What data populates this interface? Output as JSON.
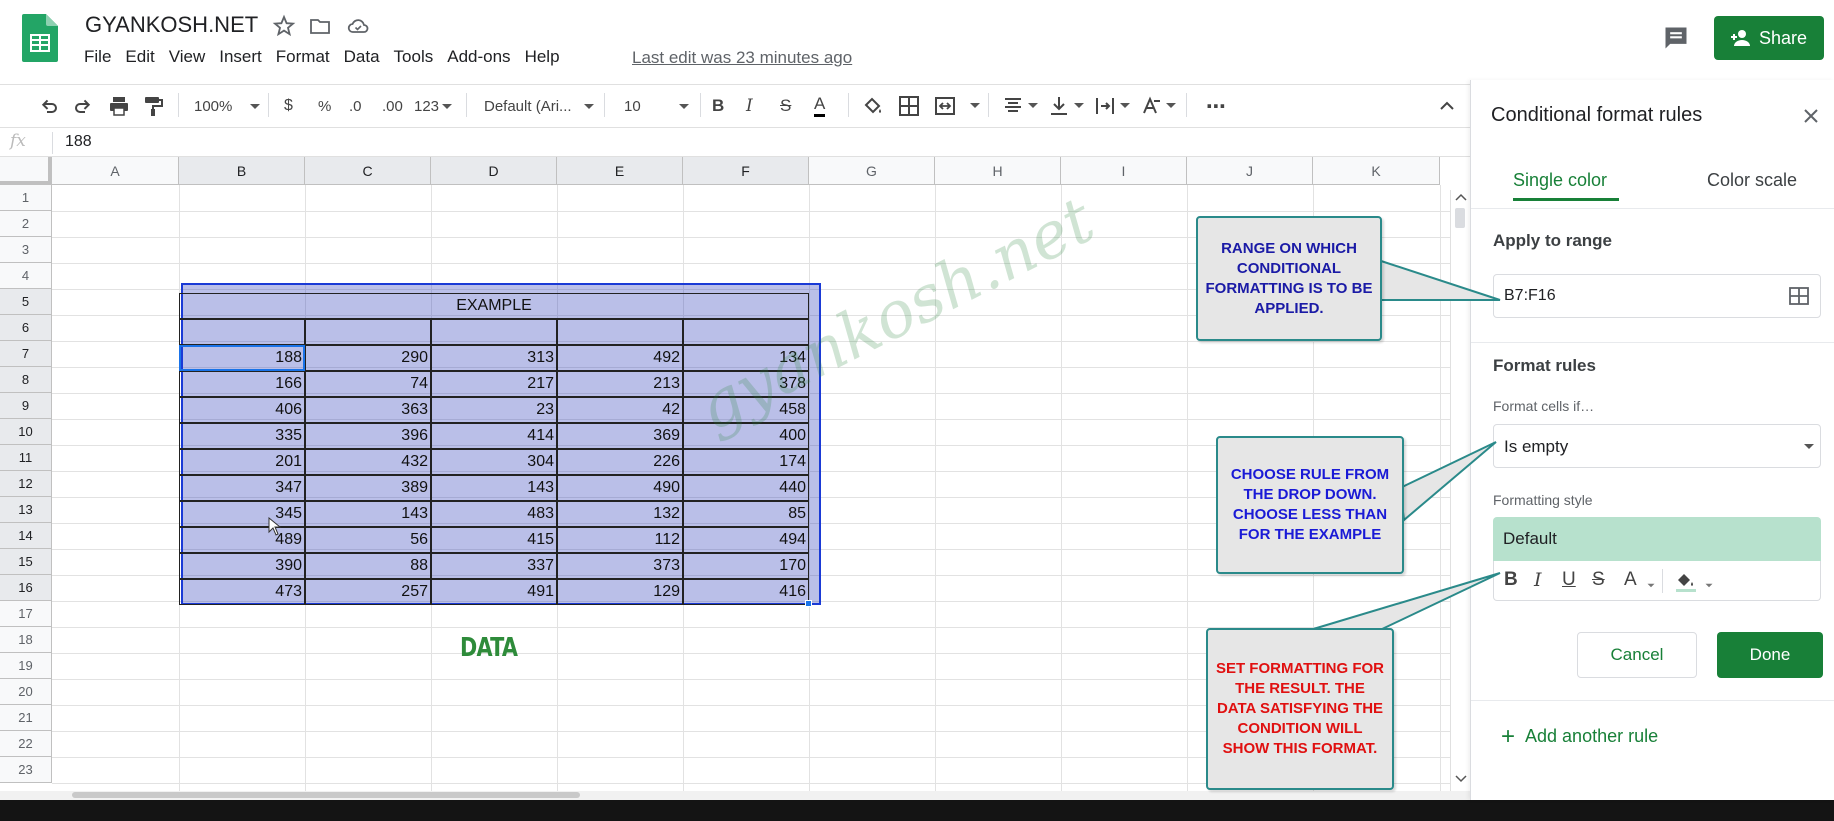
{
  "app": {
    "doc_title": "GYANKOSH.NET",
    "menu": [
      "File",
      "Edit",
      "View",
      "Insert",
      "Format",
      "Data",
      "Tools",
      "Add-ons",
      "Help"
    ],
    "last_edit": "Last edit was 23 minutes ago",
    "share_label": "Share",
    "brand_color": "#188038"
  },
  "toolbar": {
    "zoom": "100%",
    "currency": "$",
    "percent": "%",
    "decrease_decimal": ".0",
    "increase_decimal": ".00",
    "more_formats": "123",
    "font_family": "Default (Ari...",
    "font_size": "10",
    "bold": "B",
    "italic": "I",
    "strikethrough": "S",
    "text_color": "A",
    "more": "⋯"
  },
  "formula_bar": {
    "label": "fx",
    "value": "188"
  },
  "grid": {
    "columns": [
      "A",
      "B",
      "C",
      "D",
      "E",
      "F",
      "G",
      "H",
      "I",
      "J",
      "K"
    ],
    "rows": [
      "1",
      "2",
      "3",
      "4",
      "5",
      "6",
      "7",
      "8",
      "9",
      "10",
      "11",
      "12",
      "13",
      "14",
      "15",
      "16",
      "17",
      "18",
      "19",
      "20",
      "21",
      "22",
      "23"
    ],
    "example_title": "EXAMPLE",
    "table": [
      [
        "188",
        "290",
        "313",
        "492",
        "134"
      ],
      [
        "166",
        "74",
        "217",
        "213",
        "378"
      ],
      [
        "406",
        "363",
        "23",
        "42",
        "458"
      ],
      [
        "335",
        "396",
        "414",
        "369",
        "400"
      ],
      [
        "201",
        "432",
        "304",
        "226",
        "174"
      ],
      [
        "347",
        "389",
        "143",
        "490",
        "440"
      ],
      [
        "345",
        "143",
        "483",
        "132",
        "85"
      ],
      [
        "489",
        "56",
        "415",
        "112",
        "494"
      ],
      [
        "390",
        "88",
        "337",
        "373",
        "170"
      ],
      [
        "473",
        "257",
        "491",
        "129",
        "416"
      ]
    ],
    "data_label": "DATA",
    "watermark": "gyankosh.net"
  },
  "panel": {
    "title": "Conditional format rules",
    "tab_single": "Single color",
    "tab_scale": "Color scale",
    "apply_label": "Apply to range",
    "range_value": "B7:F16",
    "rules_label": "Format rules",
    "cells_if_label": "Format cells if…",
    "condition_value": "Is empty",
    "style_label": "Formatting style",
    "style_preview": "Default",
    "style_buttons": [
      "B",
      "I",
      "U",
      "S",
      "A"
    ],
    "cancel_label": "Cancel",
    "done_label": "Done",
    "add_rule_label": "Add another rule",
    "preview_color": "#b7e1cd"
  },
  "callouts": [
    {
      "text": "RANGE ON WHICH CONDITIONAL FORMATTING IS TO BE APPLIED.",
      "color": "#1a1aa6"
    },
    {
      "text": "CHOOSE RULE FROM THE DROP DOWN. CHOOSE LESS THAN FOR THE EXAMPLE",
      "color": "#1a1ad6"
    },
    {
      "text": "SET FORMATTING FOR THE RESULT. THE DATA SATISFYING THE CONDITION WILL SHOW THIS FORMAT.",
      "color": "#e01010"
    }
  ]
}
